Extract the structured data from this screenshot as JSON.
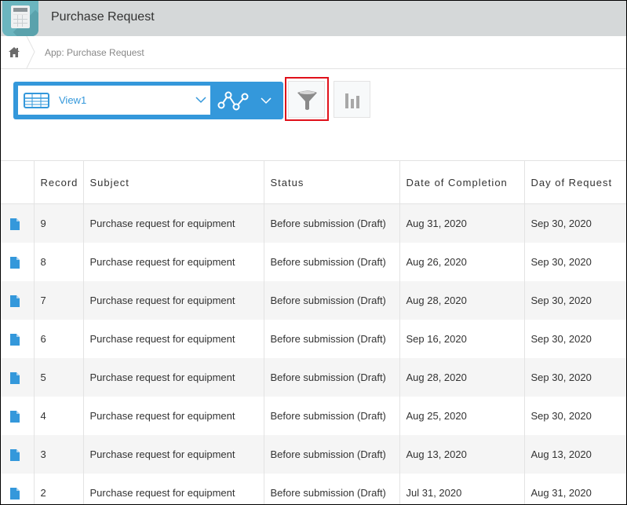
{
  "app": {
    "title": "Purchase Request",
    "icon": "calculator-app-icon"
  },
  "breadcrumb": {
    "home_icon": "home-icon",
    "items": [
      "App: Purchase Request"
    ]
  },
  "toolbar": {
    "view_select": {
      "selected": "View1",
      "icon": "table-view-icon"
    },
    "graph_menu_icon": "graph-line-icon",
    "filter_icon": "filter-funnel-icon",
    "filter_highlighted": true,
    "chart_icon": "bar-chart-icon",
    "accent_color": "#3498db",
    "highlight_color": "#e0101a"
  },
  "table": {
    "columns": [
      "",
      "Record",
      "Subject",
      "Status",
      "Date of Completion",
      "Day of Request"
    ],
    "rows": [
      {
        "record": "9",
        "subject": "Purchase request for equipment",
        "status": "Before submission (Draft)",
        "completion": "Aug 31, 2020",
        "request": "Sep 30, 2020"
      },
      {
        "record": "8",
        "subject": "Purchase request for equipment",
        "status": "Before submission (Draft)",
        "completion": "Aug 26, 2020",
        "request": "Sep 30, 2020"
      },
      {
        "record": "7",
        "subject": "Purchase request for equipment",
        "status": "Before submission (Draft)",
        "completion": "Aug 28, 2020",
        "request": "Sep 30, 2020"
      },
      {
        "record": "6",
        "subject": "Purchase request for equipment",
        "status": "Before submission (Draft)",
        "completion": "Sep 16, 2020",
        "request": "Sep 30, 2020"
      },
      {
        "record": "5",
        "subject": "Purchase request for equipment",
        "status": "Before submission (Draft)",
        "completion": "Aug 28, 2020",
        "request": "Sep 30, 2020"
      },
      {
        "record": "4",
        "subject": "Purchase request for equipment",
        "status": "Before submission (Draft)",
        "completion": "Aug 25, 2020",
        "request": "Sep 30, 2020"
      },
      {
        "record": "3",
        "subject": "Purchase request for equipment",
        "status": "Before submission (Draft)",
        "completion": "Aug 13, 2020",
        "request": "Aug 13, 2020"
      },
      {
        "record": "2",
        "subject": "Purchase request for equipment",
        "status": "Before submission (Draft)",
        "completion": "Jul 31, 2020",
        "request": "Aug 31, 2020"
      }
    ],
    "row_icon": "record-detail-icon"
  }
}
